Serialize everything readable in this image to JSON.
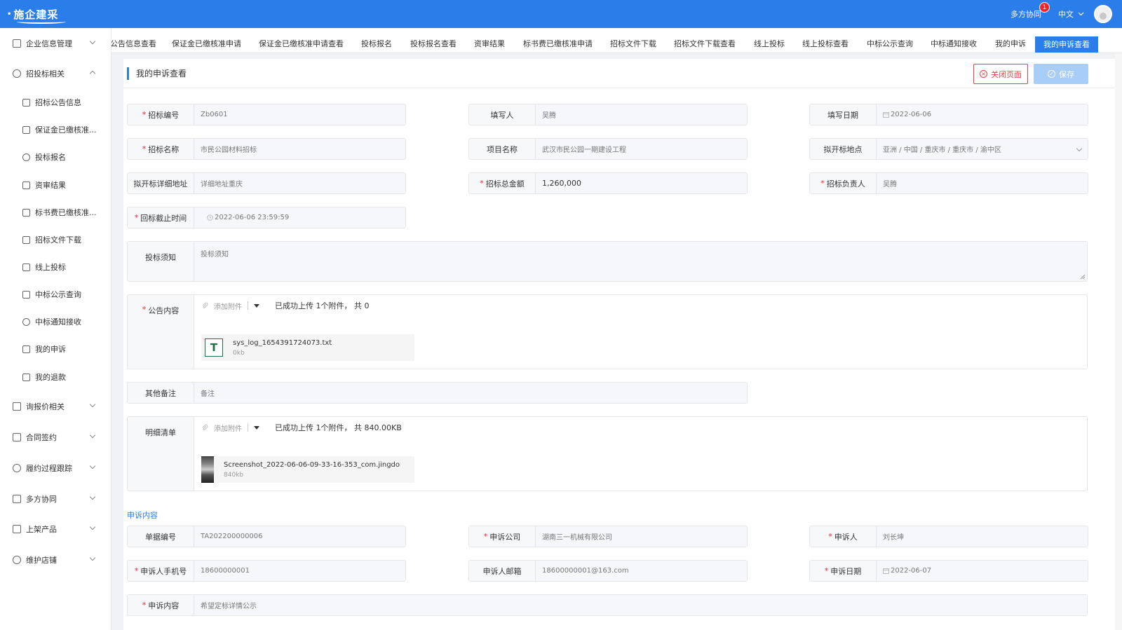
{
  "header": {
    "logo_text": "施企建采",
    "collab_label": "多方协同",
    "collab_badge": "1",
    "lang_label": "中文"
  },
  "sidebar": {
    "items": [
      {
        "label": "企业信息管理",
        "icon": "file-icon",
        "level": 0,
        "expanded": false
      },
      {
        "label": "招投标相关",
        "icon": "target-icon",
        "level": 0,
        "expanded": true
      },
      {
        "label": "招标公告信息",
        "icon": "doc-icon",
        "level": 1
      },
      {
        "label": "保证金已缴核准...",
        "icon": "clipboard-icon",
        "level": 1
      },
      {
        "label": "投标报名",
        "icon": "user-icon",
        "level": 1
      },
      {
        "label": "资审结果",
        "icon": "check-clipboard-icon",
        "level": 1
      },
      {
        "label": "标书费已缴核准...",
        "icon": "doc-icon",
        "level": 1
      },
      {
        "label": "招标文件下载",
        "icon": "org-icon",
        "level": 1
      },
      {
        "label": "线上投标",
        "icon": "doc-icon",
        "level": 1
      },
      {
        "label": "中标公示查询",
        "icon": "list-icon",
        "level": 1
      },
      {
        "label": "中标通知接收",
        "icon": "user-icon",
        "level": 1
      },
      {
        "label": "我的申诉",
        "icon": "doc-icon",
        "level": 1
      },
      {
        "label": "我的退款",
        "icon": "doc-icon",
        "level": 1
      },
      {
        "label": "询报价相关",
        "icon": "doc-icon",
        "level": 0,
        "expanded": false
      },
      {
        "label": "合同签约",
        "icon": "doc-icon",
        "level": 0,
        "expanded": false
      },
      {
        "label": "履约过程跟踪",
        "icon": "user-icon",
        "level": 0,
        "expanded": false
      },
      {
        "label": "多方协同",
        "icon": "grid-icon",
        "level": 0,
        "expanded": false
      },
      {
        "label": "上架产品",
        "icon": "grid-icon",
        "level": 0,
        "expanded": false
      },
      {
        "label": "维护店铺",
        "icon": "user-icon",
        "level": 0,
        "expanded": false
      }
    ]
  },
  "tabs": [
    "公告信息查看",
    "保证金已缴核准申请",
    "保证金已缴核准申请查看",
    "投标报名",
    "投标报名查看",
    "资审结果",
    "标书费已缴核准申请",
    "招标文件下载",
    "招标文件下载查看",
    "线上投标",
    "线上投标查看",
    "中标公示查询",
    "中标通知接收",
    "我的申诉",
    "我的申诉查看"
  ],
  "active_tab": "我的申诉查看",
  "page": {
    "title": "我的申诉查看",
    "close_label": "关闭页面",
    "save_label": "保存"
  },
  "form": {
    "bid_no": {
      "label": "招标编号",
      "value": "Zb0601",
      "required": true
    },
    "filler": {
      "label": "填写人",
      "value": "吴腾",
      "required": false
    },
    "fill_date": {
      "label": "填写日期",
      "value": "2022-06-06",
      "required": false
    },
    "bid_name": {
      "label": "招标名称",
      "value": "市民公园材料招标",
      "required": true
    },
    "project_name": {
      "label": "项目名称",
      "value": "武汉市民公园一期建设工程",
      "required": false
    },
    "open_place": {
      "label": "拟开标地点",
      "value": "亚洲 / 中国 / 重庆市 / 重庆市 / 渝中区",
      "required": false
    },
    "open_address": {
      "label": "拟开标详细地址",
      "value": "详细地址重庆",
      "required": false
    },
    "total_amount": {
      "label": "招标总金额",
      "value": "1,260,000",
      "required": true
    },
    "principal": {
      "label": "招标负责人",
      "value": "吴腾",
      "required": true
    },
    "deadline": {
      "label": "回标截止时间",
      "value": "2022-06-06 23:59:59",
      "required": true
    },
    "notice": {
      "label": "投标须知",
      "value": "投标须知"
    },
    "announcement": {
      "label": "公告内容",
      "upload_label": "添加附件",
      "status": "已成功上传 1个附件， 共 0",
      "file_name": "sys_log_1654391724073.txt",
      "file_size": "0kb",
      "file_icon_letter": "T"
    },
    "remark": {
      "label": "其他备注",
      "value": "备注"
    },
    "details": {
      "label": "明细清单",
      "upload_label": "添加附件",
      "status": "已成功上传 1个附件， 共 840.00KB",
      "file_name": "Screenshot_2022-06-06-09-33-16-353_com.jingdong....",
      "file_size": "840kb"
    }
  },
  "appeal": {
    "section_title": "申诉内容",
    "doc_no": {
      "label": "单据编号",
      "value": "TA202200000006",
      "required": false
    },
    "company": {
      "label": "申诉公司",
      "value": "湖南三一机械有限公司",
      "required": true
    },
    "person": {
      "label": "申诉人",
      "value": "刘长坤",
      "required": true
    },
    "phone": {
      "label": "申诉人手机号",
      "value": "18600000001",
      "required": true
    },
    "email": {
      "label": "申诉人邮箱",
      "value": "18600000001@163.com",
      "required": false
    },
    "date": {
      "label": "申诉日期",
      "value": "2022-06-07",
      "required": true
    },
    "content": {
      "label": "申诉内容",
      "value": "希望定标详情公示",
      "required": true
    }
  },
  "colors": {
    "primary": "#2b7de9",
    "danger": "#e64242",
    "required": "#f5222d"
  }
}
